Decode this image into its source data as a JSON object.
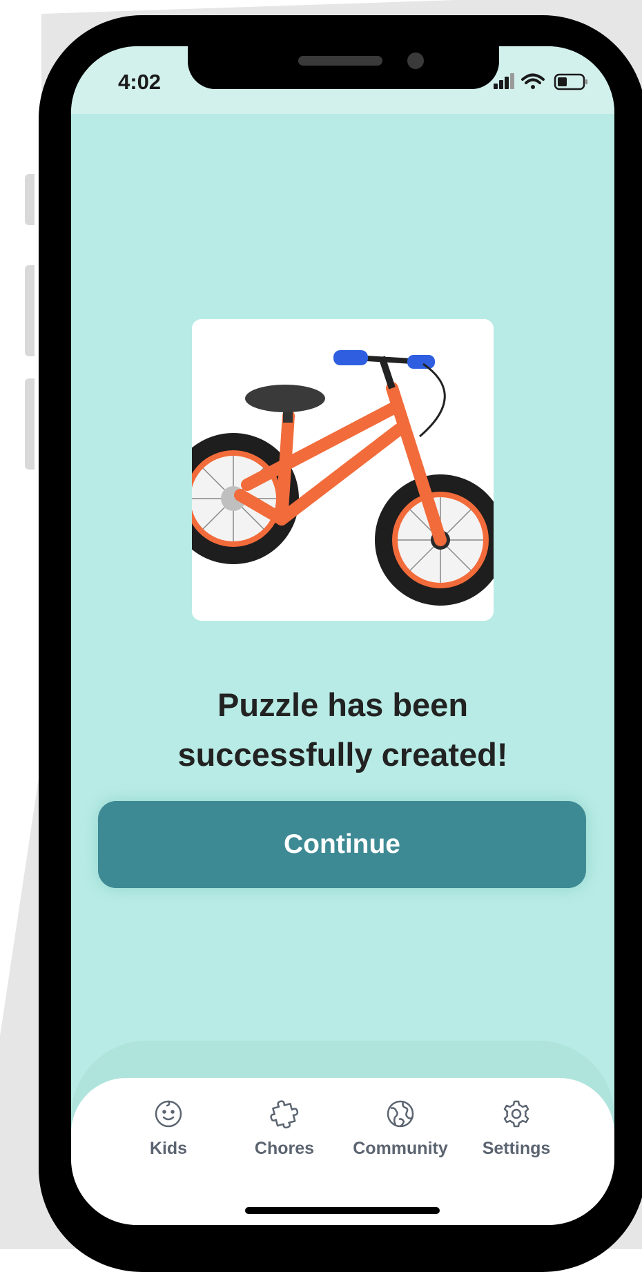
{
  "status_bar": {
    "time": "4:02",
    "icons": [
      "cellular-signal-icon",
      "wifi-icon",
      "battery-icon"
    ]
  },
  "main": {
    "image": "orange-balance-bike-photo",
    "message_line1": "Puzzle has been",
    "message_line2": "successfully created!",
    "continue_label": "Continue"
  },
  "tabbar": {
    "items": [
      {
        "label": "Kids",
        "icon": "smiley-face-icon"
      },
      {
        "label": "Chores",
        "icon": "puzzle-piece-icon"
      },
      {
        "label": "Community",
        "icon": "globe-icon"
      },
      {
        "label": "Settings",
        "icon": "gear-icon"
      }
    ]
  },
  "colors": {
    "screen_bg": "#b8ebe5",
    "status_bg": "#d2f0ec",
    "button": "#3e8a94",
    "bike_frame": "#f26b3a",
    "bike_grips": "#2f5fe0",
    "tab_text": "#5b6470"
  }
}
